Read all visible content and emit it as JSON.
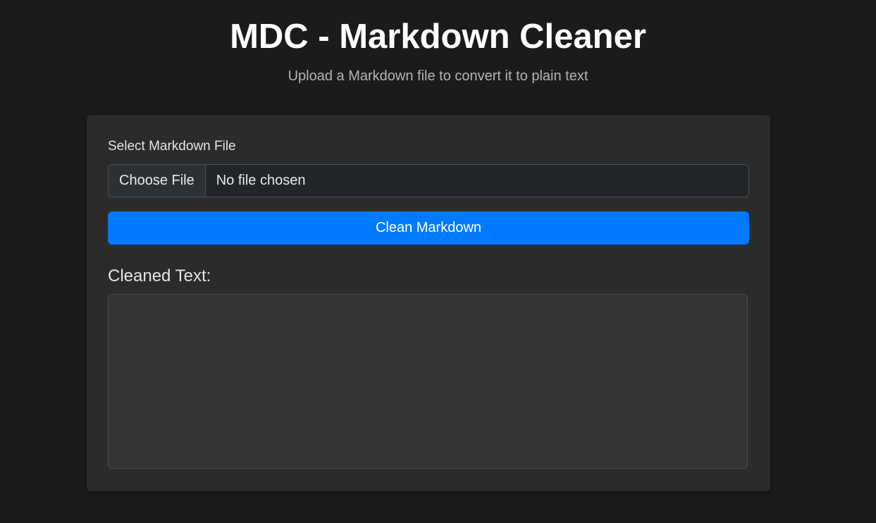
{
  "header": {
    "title": "MDC - Markdown Cleaner",
    "subtitle": "Upload a Markdown file to convert it to plain text"
  },
  "form": {
    "file_label": "Select Markdown File",
    "file_button_label": "Choose File",
    "file_status": "No file chosen",
    "submit_label": "Clean Markdown"
  },
  "output": {
    "label": "Cleaned Text:",
    "value": ""
  },
  "colors": {
    "background": "#1b1b1b",
    "card": "#2b2b2b",
    "accent": "#007bff"
  }
}
